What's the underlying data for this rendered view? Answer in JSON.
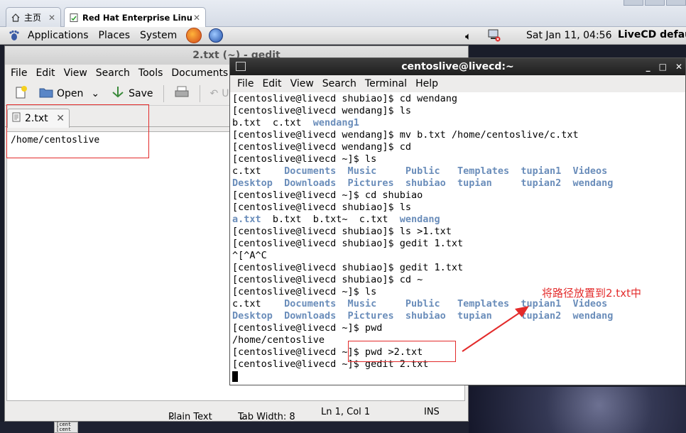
{
  "browser": {
    "tabs": [
      {
        "label": "主页",
        "icon": "home-icon",
        "active": false
      },
      {
        "label": "Red Hat Enterprise Linux ...",
        "icon": "page-icon",
        "active": true
      }
    ]
  },
  "panel": {
    "menus": [
      "Applications",
      "Places",
      "System"
    ],
    "clock": "Sat Jan 11, 04:56",
    "user": "LiveCD defau"
  },
  "gedit": {
    "title": "2.txt (~) - gedit",
    "menu": [
      "File",
      "Edit",
      "View",
      "Search",
      "Tools",
      "Documents"
    ],
    "toolbar": {
      "open": "Open",
      "save": "Save",
      "undo": "U"
    },
    "doc_tab": "2.txt",
    "content": "/home/centoslive",
    "status": {
      "lang": "Plain Text",
      "tab": "Tab Width:  8",
      "pos": "Ln 1, Col 1",
      "mode": "INS"
    }
  },
  "terminal": {
    "title": "centoslive@livecd:~",
    "menu": [
      "File",
      "Edit",
      "View",
      "Search",
      "Terminal",
      "Help"
    ],
    "lines": [
      [
        {
          "t": "[centoslive@livecd shubiao]$ cd wendang"
        }
      ],
      [
        {
          "t": "[centoslive@livecd wendang]$ ls"
        }
      ],
      [
        {
          "t": "b.txt  c.txt  "
        },
        {
          "t": "wendang1",
          "c": "blue"
        }
      ],
      [
        {
          "t": "[centoslive@livecd wendang]$ mv b.txt /home/centoslive/c.txt"
        }
      ],
      [
        {
          "t": "[centoslive@livecd wendang]$ cd"
        }
      ],
      [
        {
          "t": "[centoslive@livecd ~]$ ls"
        }
      ],
      [
        {
          "t": "c.txt    "
        },
        {
          "t": "Documents  Music     Public   Templates  tupian1  Videos",
          "c": "blue"
        }
      ],
      [
        {
          "t": "Desktop  Downloads  Pictures  shubiao  tupian     tupian2  wendang",
          "c": "blue"
        }
      ],
      [
        {
          "t": "[centoslive@livecd ~]$ cd shubiao"
        }
      ],
      [
        {
          "t": "[centoslive@livecd shubiao]$ ls"
        }
      ],
      [
        {
          "t": "a.txt",
          "c": "blue"
        },
        {
          "t": "  b.txt  b.txt~  c.txt  "
        },
        {
          "t": "wendang",
          "c": "blue"
        }
      ],
      [
        {
          "t": "[centoslive@livecd shubiao]$ ls >1.txt"
        }
      ],
      [
        {
          "t": "[centoslive@livecd shubiao]$ gedit 1.txt"
        }
      ],
      [
        {
          "t": "^[^A^C"
        }
      ],
      [
        {
          "t": "[centoslive@livecd shubiao]$ gedit 1.txt"
        }
      ],
      [
        {
          "t": "[centoslive@livecd shubiao]$ cd ~"
        }
      ],
      [
        {
          "t": "[centoslive@livecd ~]$ ls"
        }
      ],
      [
        {
          "t": "c.txt    "
        },
        {
          "t": "Documents  Music     Public   Templates  tupian1  Videos",
          "c": "blue"
        }
      ],
      [
        {
          "t": "Desktop  Downloads  Pictures  shubiao  tupian     tupian2  wendang",
          "c": "blue"
        }
      ],
      [
        {
          "t": "[centoslive@livecd ~]$ pwd"
        }
      ],
      [
        {
          "t": "/home/centoslive"
        }
      ],
      [
        {
          "t": "[centoslive@livecd ~]$ pwd >2.txt"
        }
      ],
      [
        {
          "t": "[centoslive@livecd ~]$ gedit 2.txt"
        }
      ]
    ]
  },
  "annotation": {
    "text": "将路径放置到2.txt中",
    "color": "#e32b2b"
  },
  "taskbar_button": "[cent\n[cent"
}
